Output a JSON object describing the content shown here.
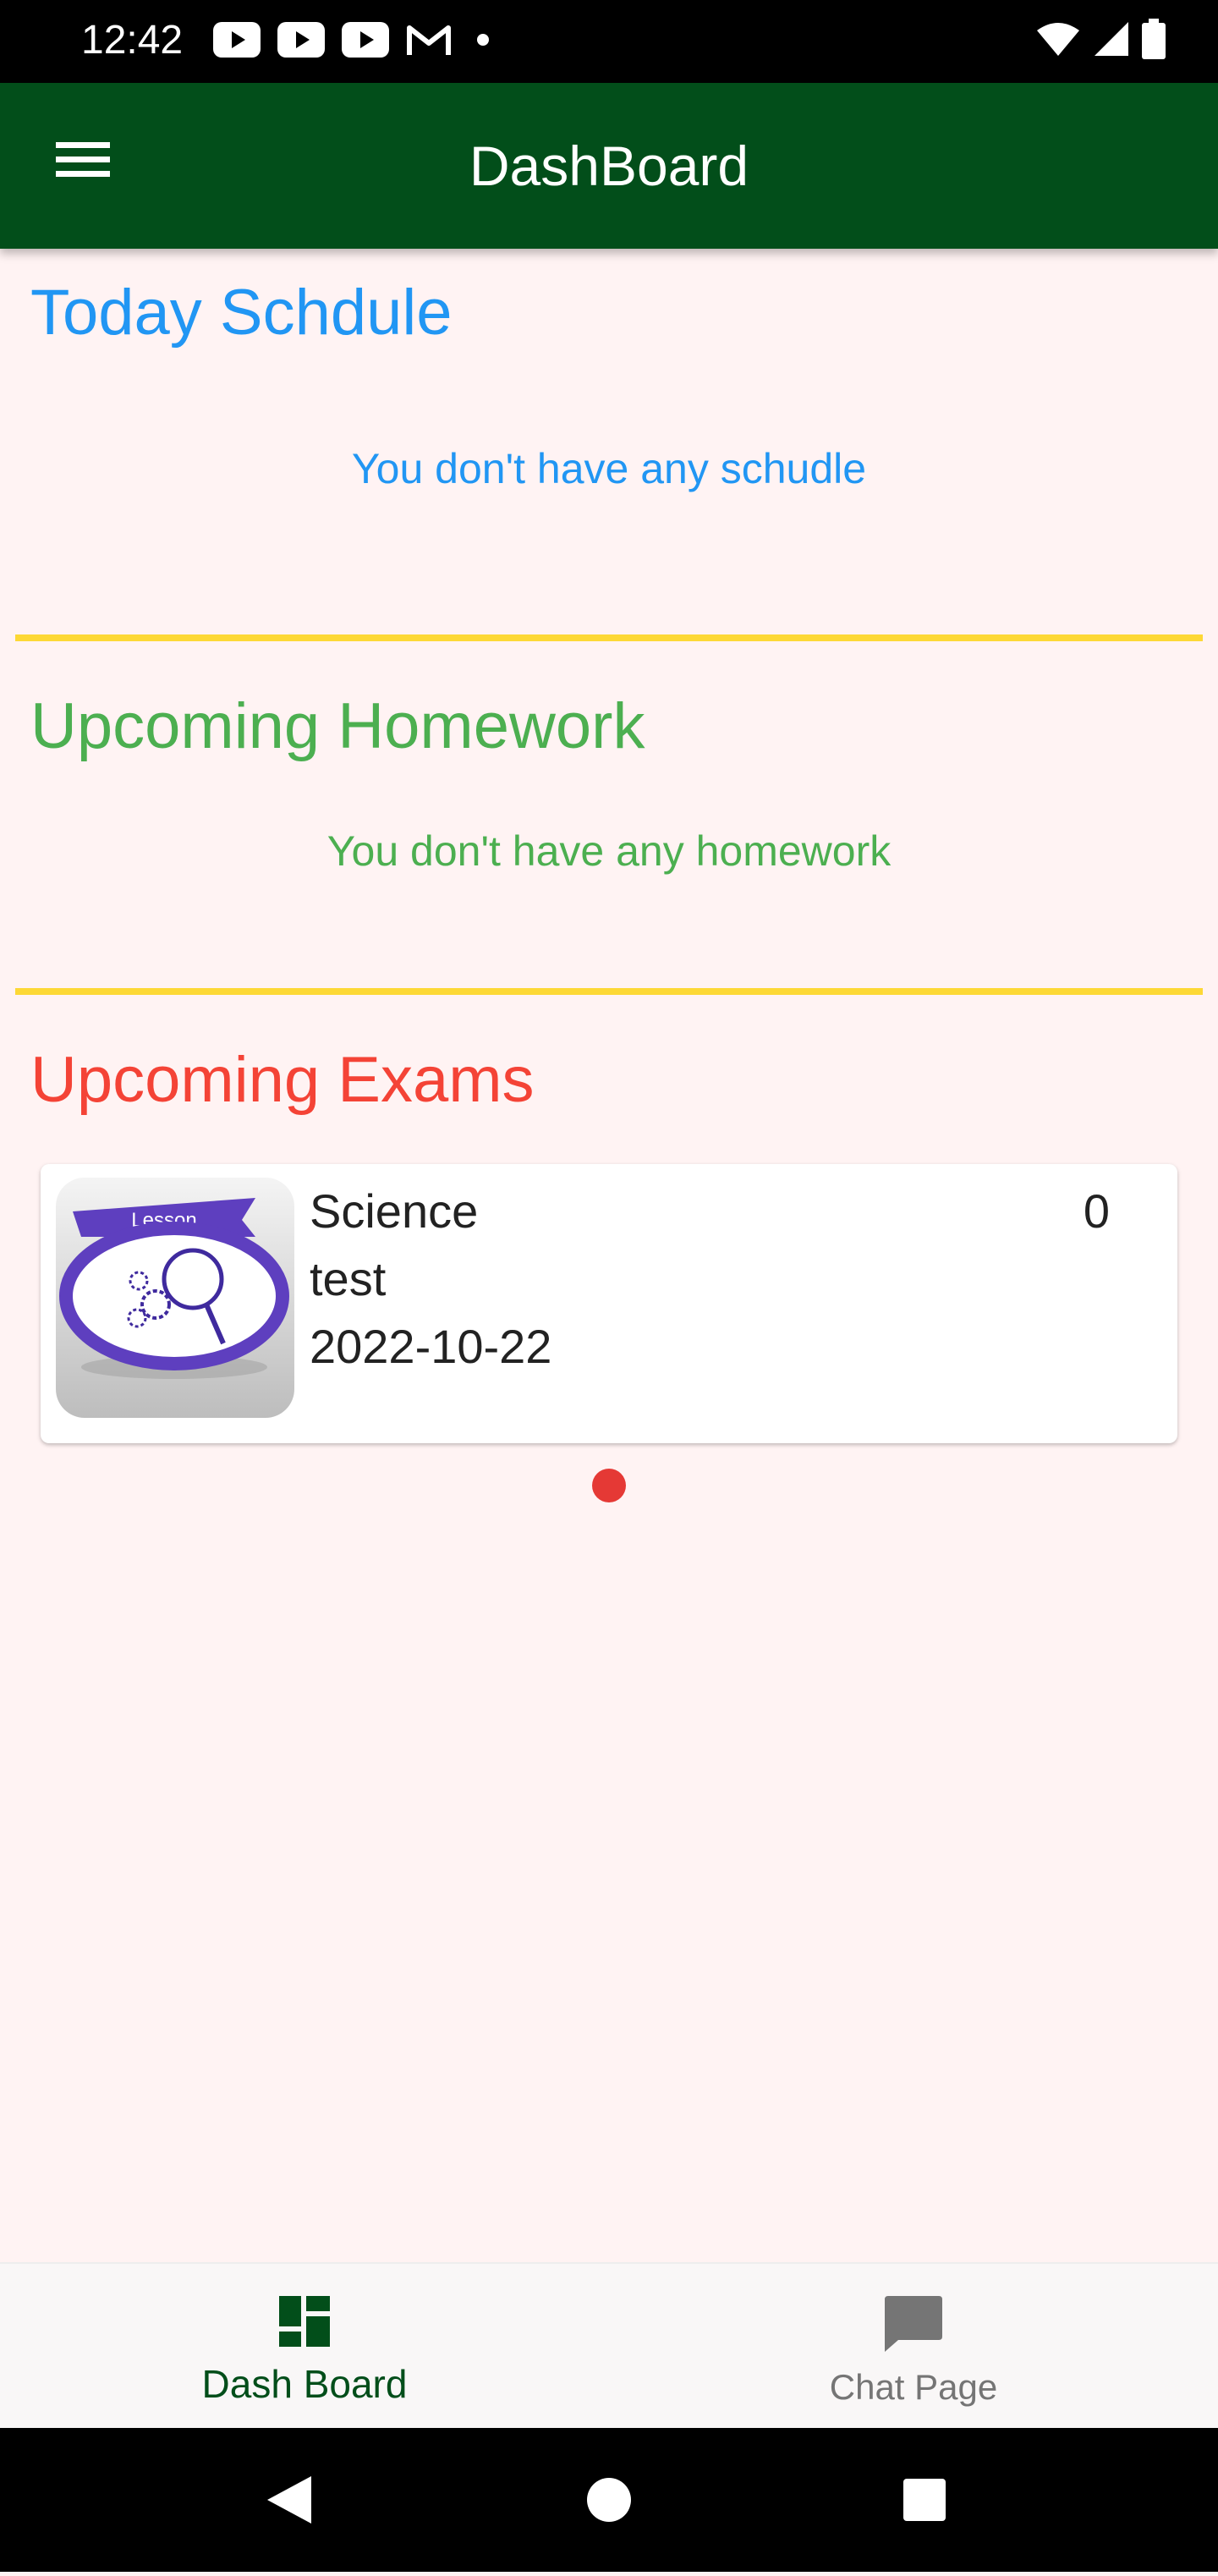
{
  "status_bar": {
    "time": "12:42",
    "left_icons": [
      "youtube-icon",
      "youtube-icon",
      "youtube-icon",
      "gmail-icon",
      "dot-icon"
    ],
    "right_icons": [
      "wifi-icon",
      "signal-icon",
      "battery-icon"
    ]
  },
  "app_bar": {
    "title": "DashBoard",
    "menu_icon": "hamburger-menu-icon"
  },
  "schedule": {
    "title": "Today Schdule",
    "empty_message": "You don't have any schudle",
    "color": "#2196f3"
  },
  "homework": {
    "title": "Upcoming Homework",
    "empty_message": "You don't have any homework",
    "color": "#4caf50"
  },
  "exams": {
    "title": "Upcoming Exams",
    "color": "#f44336",
    "items": [
      {
        "subject": "Science",
        "name": "test",
        "date": "2022-10-22",
        "count": "0",
        "image_label": "Lesson"
      }
    ]
  },
  "bottom_nav": {
    "items": [
      {
        "label": "Dash Board",
        "icon": "dashboard-icon",
        "active": true,
        "color": "#024e1a"
      },
      {
        "label": "Chat Page",
        "icon": "chat-icon",
        "active": false,
        "color": "#757575"
      }
    ]
  },
  "divider_color": "#fdd835",
  "system_nav": [
    "back-icon",
    "home-icon",
    "recents-icon"
  ]
}
